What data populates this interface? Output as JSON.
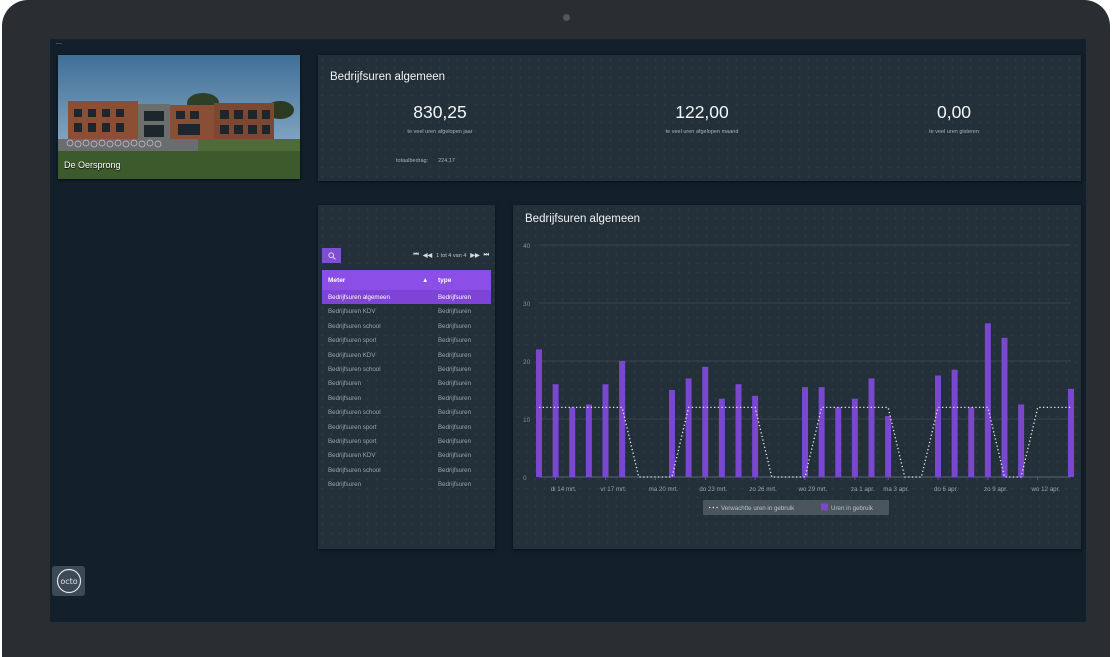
{
  "site": {
    "name": "De Oersprong"
  },
  "kpi": {
    "title": "Bedrijfsuren algemeen",
    "items": [
      {
        "value": "830,25",
        "label": "te veel uren afgelopen jaar"
      },
      {
        "value": "122,00",
        "label": "te veel uren afgelopen maand"
      },
      {
        "value": "0,00",
        "label": "te veel uren gisteren"
      }
    ],
    "total_label": "totaalbedrag:",
    "total_value": "224,17"
  },
  "list": {
    "search_icon": "search-icon",
    "pager": {
      "first": "⏮",
      "prev": "◀◀",
      "info": "1 tot 4 van 4",
      "next": "▶▶",
      "last": "⏭"
    },
    "columns": {
      "meter": "Meter",
      "sort": "▲",
      "type": "type"
    },
    "rows": [
      {
        "meter": "Bedrijfsuren algemeen",
        "type": "Bedrijfsuren",
        "selected": true
      },
      {
        "meter": "Bedrijfsuren KDV",
        "type": "Bedrijfsuren"
      },
      {
        "meter": "Bedrijfsuren school",
        "type": "Bedrijfsuren"
      },
      {
        "meter": "Bedrijfsuren sport",
        "type": "Bedrijfsuren"
      },
      {
        "meter": "Bedrijfsuren KDV",
        "type": "Bedrijfsuren"
      },
      {
        "meter": "Bedrijfsuren school",
        "type": "Bedrijfsuren"
      },
      {
        "meter": "Bedrijfsuren",
        "type": "Bedrijfsuren"
      },
      {
        "meter": "Bedrijfsuren",
        "type": "Bedrijfsuren"
      },
      {
        "meter": "Bedrijfsuren school",
        "type": "Bedrijfsuren"
      },
      {
        "meter": "Bedrijfsuren sport",
        "type": "Bedrijfsuren"
      },
      {
        "meter": "Bedrijfsuren sport",
        "type": "Bedrijfsuren"
      },
      {
        "meter": "Bedrijfsuren KDV",
        "type": "Bedrijfsuren"
      },
      {
        "meter": "Bedrijfsuren school",
        "type": "Bedrijfsuren"
      },
      {
        "meter": "Bedrijfsuren",
        "type": "Bedrijfsuren"
      }
    ]
  },
  "logo": {
    "text": "octo"
  },
  "chart_data": {
    "type": "bar",
    "title": "Bedrijfsuren algemeen",
    "ylim": [
      0,
      40
    ],
    "yticks": [
      0,
      10,
      20,
      30,
      40
    ],
    "x_labels": [
      "di 14 mrt.",
      "vr 17 mrt.",
      "ma 20 mrt.",
      "do 23 mrt.",
      "zo 26 mrt.",
      "wo 29 mrt.",
      "za 1 apr.",
      "ma 3 apr.",
      "do 6 apr.",
      "zo 9 apr.",
      "wo 12 apr."
    ],
    "x_label_days": [
      1,
      4,
      7,
      10,
      13,
      16,
      19,
      21,
      24,
      27,
      30
    ],
    "days": 32,
    "grid": true,
    "legend_position": "bottom",
    "colors": {
      "bars": "#7a47d0",
      "expected": "#e6e6e6"
    },
    "series": [
      {
        "name": "Verwachtte uren in gebruik",
        "style": "dotted-line",
        "values": [
          12,
          12,
          12,
          12,
          12,
          12,
          0,
          0,
          0,
          12,
          12,
          12,
          12,
          12,
          0,
          0,
          0,
          12,
          12,
          12,
          12,
          12,
          0,
          0,
          12,
          12,
          12,
          12,
          0,
          0,
          12,
          12,
          12
        ]
      },
      {
        "name": "Uren in gebruik",
        "style": "bar",
        "values": [
          22,
          16,
          12,
          12.5,
          16,
          20,
          null,
          null,
          15,
          17,
          19,
          13.5,
          16,
          14,
          null,
          null,
          15.5,
          15.5,
          12,
          13.5,
          17,
          10.5,
          null,
          null,
          17.5,
          18.5,
          12,
          26.5,
          24,
          12.5,
          null,
          null,
          15.2,
          15,
          14
        ]
      }
    ]
  }
}
